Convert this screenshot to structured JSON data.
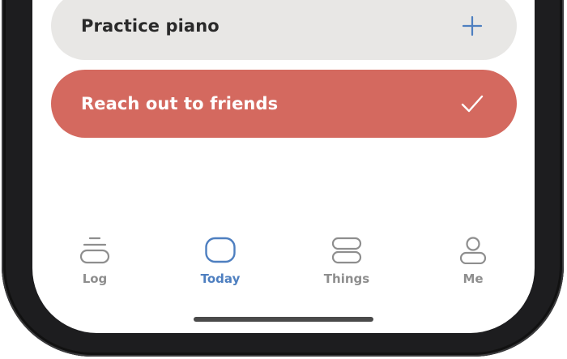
{
  "tasks": [
    {
      "label": "Practice piano",
      "action_icon": "plus-icon",
      "state": "not-done",
      "color": "#e8e7e5"
    },
    {
      "label": "Reach out to friends",
      "action_icon": "checkmark-icon",
      "state": "done",
      "color": "#d4695f"
    }
  ],
  "tabbar": {
    "tabs": [
      {
        "label": "Log",
        "icon": "log-icon",
        "active": false
      },
      {
        "label": "Today",
        "icon": "today-icon",
        "active": true
      },
      {
        "label": "Things",
        "icon": "things-icon",
        "active": false
      },
      {
        "label": "Me",
        "icon": "me-icon",
        "active": false
      }
    ]
  },
  "colors": {
    "accent": "#4e7fc0",
    "done": "#d4695f",
    "pending": "#e8e7e5",
    "inactive_tab": "#8e8e8e"
  }
}
